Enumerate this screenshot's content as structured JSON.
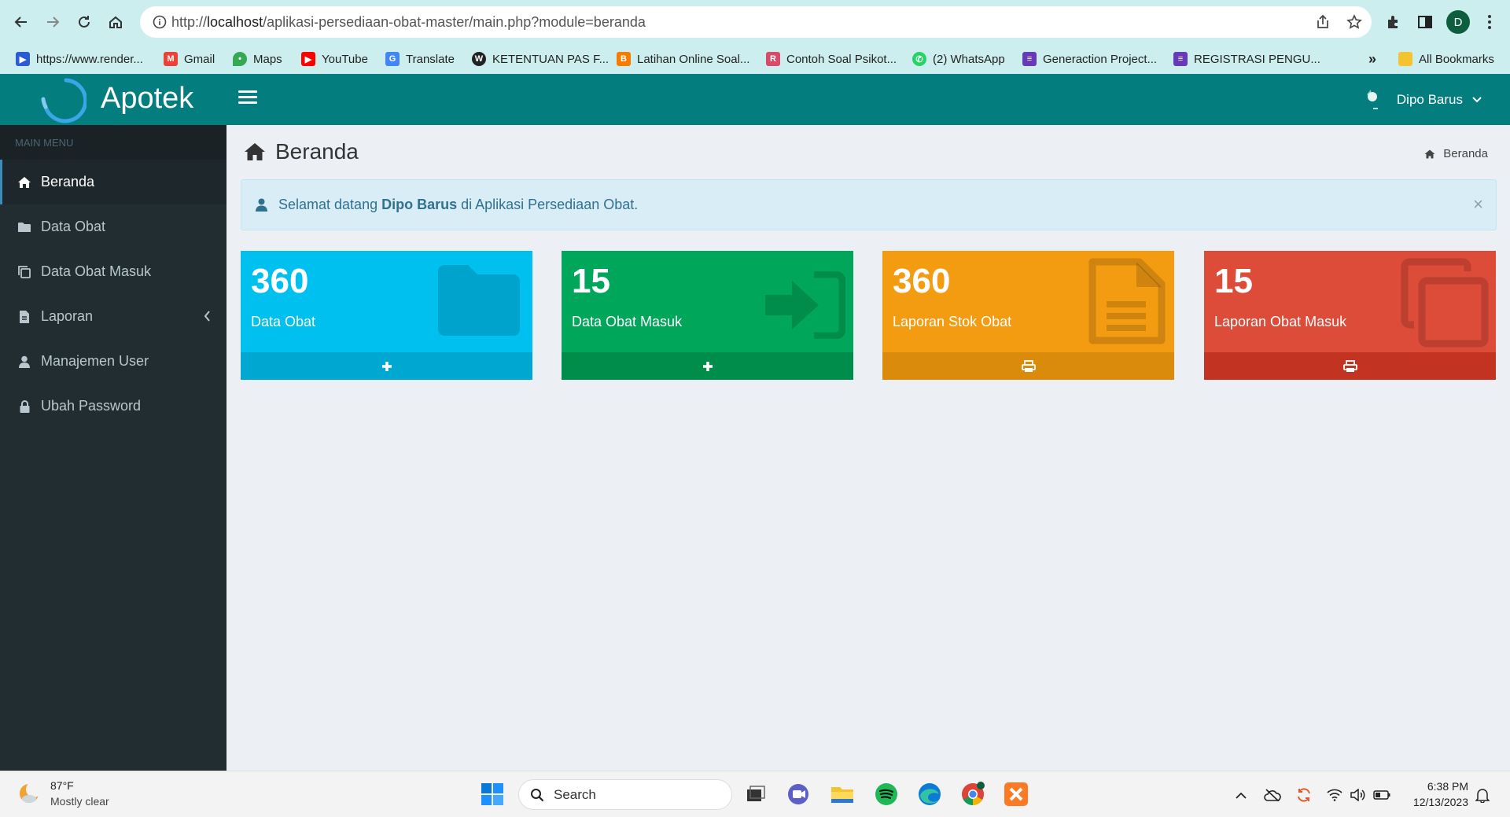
{
  "browser": {
    "url_prefix": "http://",
    "url_host": "localhost",
    "url_path": "/aplikasi-persediaan-obat-master/main.php?module=beranda",
    "profile_initial": "D",
    "bookmarks": [
      {
        "label": "https://www.render...",
        "color": "#2c5bd6"
      },
      {
        "label": "Gmail",
        "color": "#ea4335"
      },
      {
        "label": "Maps",
        "color": "#34a853"
      },
      {
        "label": "YouTube",
        "color": "#ff0000"
      },
      {
        "label": "Translate",
        "color": "#4285f4"
      },
      {
        "label": "KETENTUAN PAS F...",
        "color": "#222222"
      },
      {
        "label": "Latihan Online Soal...",
        "color": "#f57c00"
      },
      {
        "label": "Contoh Soal Psikot...",
        "color": "#d84a6a"
      },
      {
        "label": "(2) WhatsApp",
        "color": "#25d366"
      },
      {
        "label": "Generaction Project...",
        "color": "#673ab7"
      },
      {
        "label": "REGISTRASI PENGU...",
        "color": "#673ab7"
      }
    ],
    "bookmarks_overflow": "»",
    "all_bookmarks": "All Bookmarks"
  },
  "app": {
    "name": "Apotek",
    "user_name": "Dipo Barus",
    "accent_color": "#037d7d"
  },
  "sidebar": {
    "header": "MAIN MENU",
    "items": [
      {
        "label": "Beranda",
        "icon": "home-icon",
        "active": true
      },
      {
        "label": "Data Obat",
        "icon": "folder-icon"
      },
      {
        "label": "Data Obat Masuk",
        "icon": "copy-icon"
      },
      {
        "label": "Laporan",
        "icon": "file-icon"
      },
      {
        "label": "Manajemen User",
        "icon": "user-icon"
      },
      {
        "label": "Ubah Password",
        "icon": "lock-icon"
      }
    ]
  },
  "page": {
    "title": "Beranda",
    "breadcrumb": "Beranda"
  },
  "alert": {
    "prefix": "Selamat datang",
    "name": "Dipo Barus",
    "suffix": "di Aplikasi Persediaan Obat.",
    "close": "×"
  },
  "boxes": [
    {
      "value": "360",
      "label": "Data Obat",
      "color": "#00c0ef",
      "footer_color": "#00a7d0",
      "icon": "folder-icon",
      "action": "plus-icon"
    },
    {
      "value": "15",
      "label": "Data Obat Masuk",
      "color": "#00a65a",
      "footer_color": "#008d4c",
      "icon": "sign-in-icon",
      "action": "plus-icon"
    },
    {
      "value": "360",
      "label": "Laporan Stok Obat",
      "color": "#f39c12",
      "footer_color": "#db8b0b",
      "icon": "file-text-icon",
      "action": "print-icon"
    },
    {
      "value": "15",
      "label": "Laporan Obat Masuk",
      "color": "#dd4b39",
      "footer_color": "#c23321",
      "icon": "clone-icon",
      "action": "print-icon"
    }
  ],
  "taskbar": {
    "temp": "87°F",
    "weather": "Mostly clear",
    "search": "Search",
    "time": "6:38 PM",
    "date": "12/13/2023"
  }
}
